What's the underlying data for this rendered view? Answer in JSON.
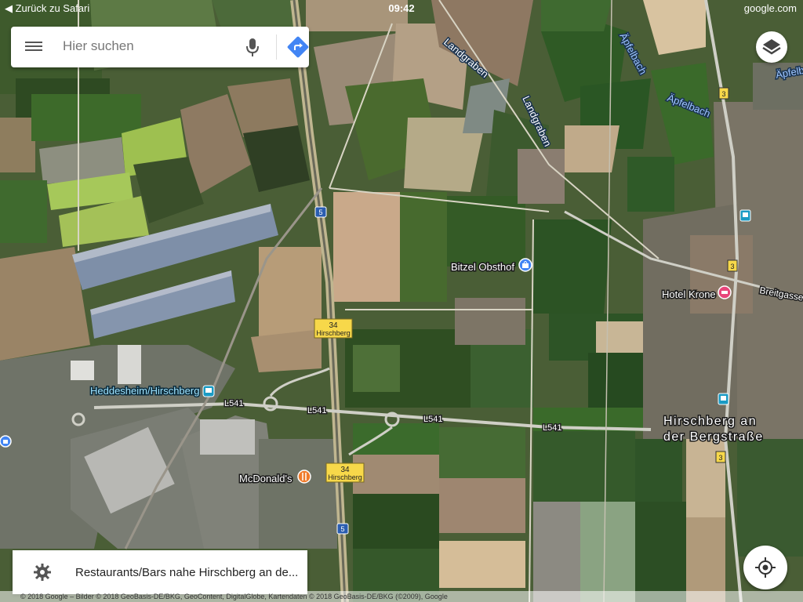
{
  "status_bar": {
    "back": "◀ Zurück zu Safari",
    "time": "09:42",
    "site": "google.com"
  },
  "search": {
    "placeholder": "Hier suchen"
  },
  "map_labels": {
    "road_landgraben_1": "Landgraben",
    "road_landgraben_2": "Landgraben",
    "river_apfelbach_1": "Äpfelbach",
    "river_apfelbach_2": "Äpfelbach",
    "river_apfelbach_3": "Äpfelbach",
    "poi_bitzel": "Bitzel Obsthof",
    "poi_hotel_krone": "Hotel Krone",
    "street_breitgasse": "Breitgasse",
    "station_heddesheim": "Heddesheim/Hirschberg",
    "road_l541_1": "L541",
    "road_l541_2": "L541",
    "road_l541_3": "L541",
    "road_l541_4": "L541",
    "town_line1": "Hirschberg an",
    "town_line2": "der Bergstraße",
    "poi_mcdonalds": "McDonald's",
    "exit_number_1": "34",
    "exit_name_1": "Hirschberg",
    "exit_number_2": "34",
    "exit_name_2": "Hirschberg",
    "shield_a5_1": "5",
    "shield_a5_2": "5",
    "shield_b3_1": "3",
    "shield_b3_2": "3",
    "shield_b3_3": "3"
  },
  "bottom_card": {
    "text": "Restaurants/Bars nahe Hirschberg an de..."
  },
  "copyright": "© 2018 Google – Bilder © 2018 GeoBasis-DE/BKG, GeoContent, DigitalGlobe, Kartendaten © 2018 GeoBasis-DE/BKG (©2009), Google",
  "colors": {
    "accent": "#4285f4",
    "poi_pink": "#e8457a",
    "poi_orange": "#f07b2b",
    "transit": "#1a9bc4",
    "road_shield": "#f7d84a"
  },
  "icons": [
    "menu-icon",
    "mic-icon",
    "directions-icon",
    "layers-icon",
    "gear-icon",
    "my-location-icon",
    "shopping-bag-icon",
    "restaurant-icon",
    "hotel-icon",
    "train-icon",
    "bus-icon"
  ]
}
